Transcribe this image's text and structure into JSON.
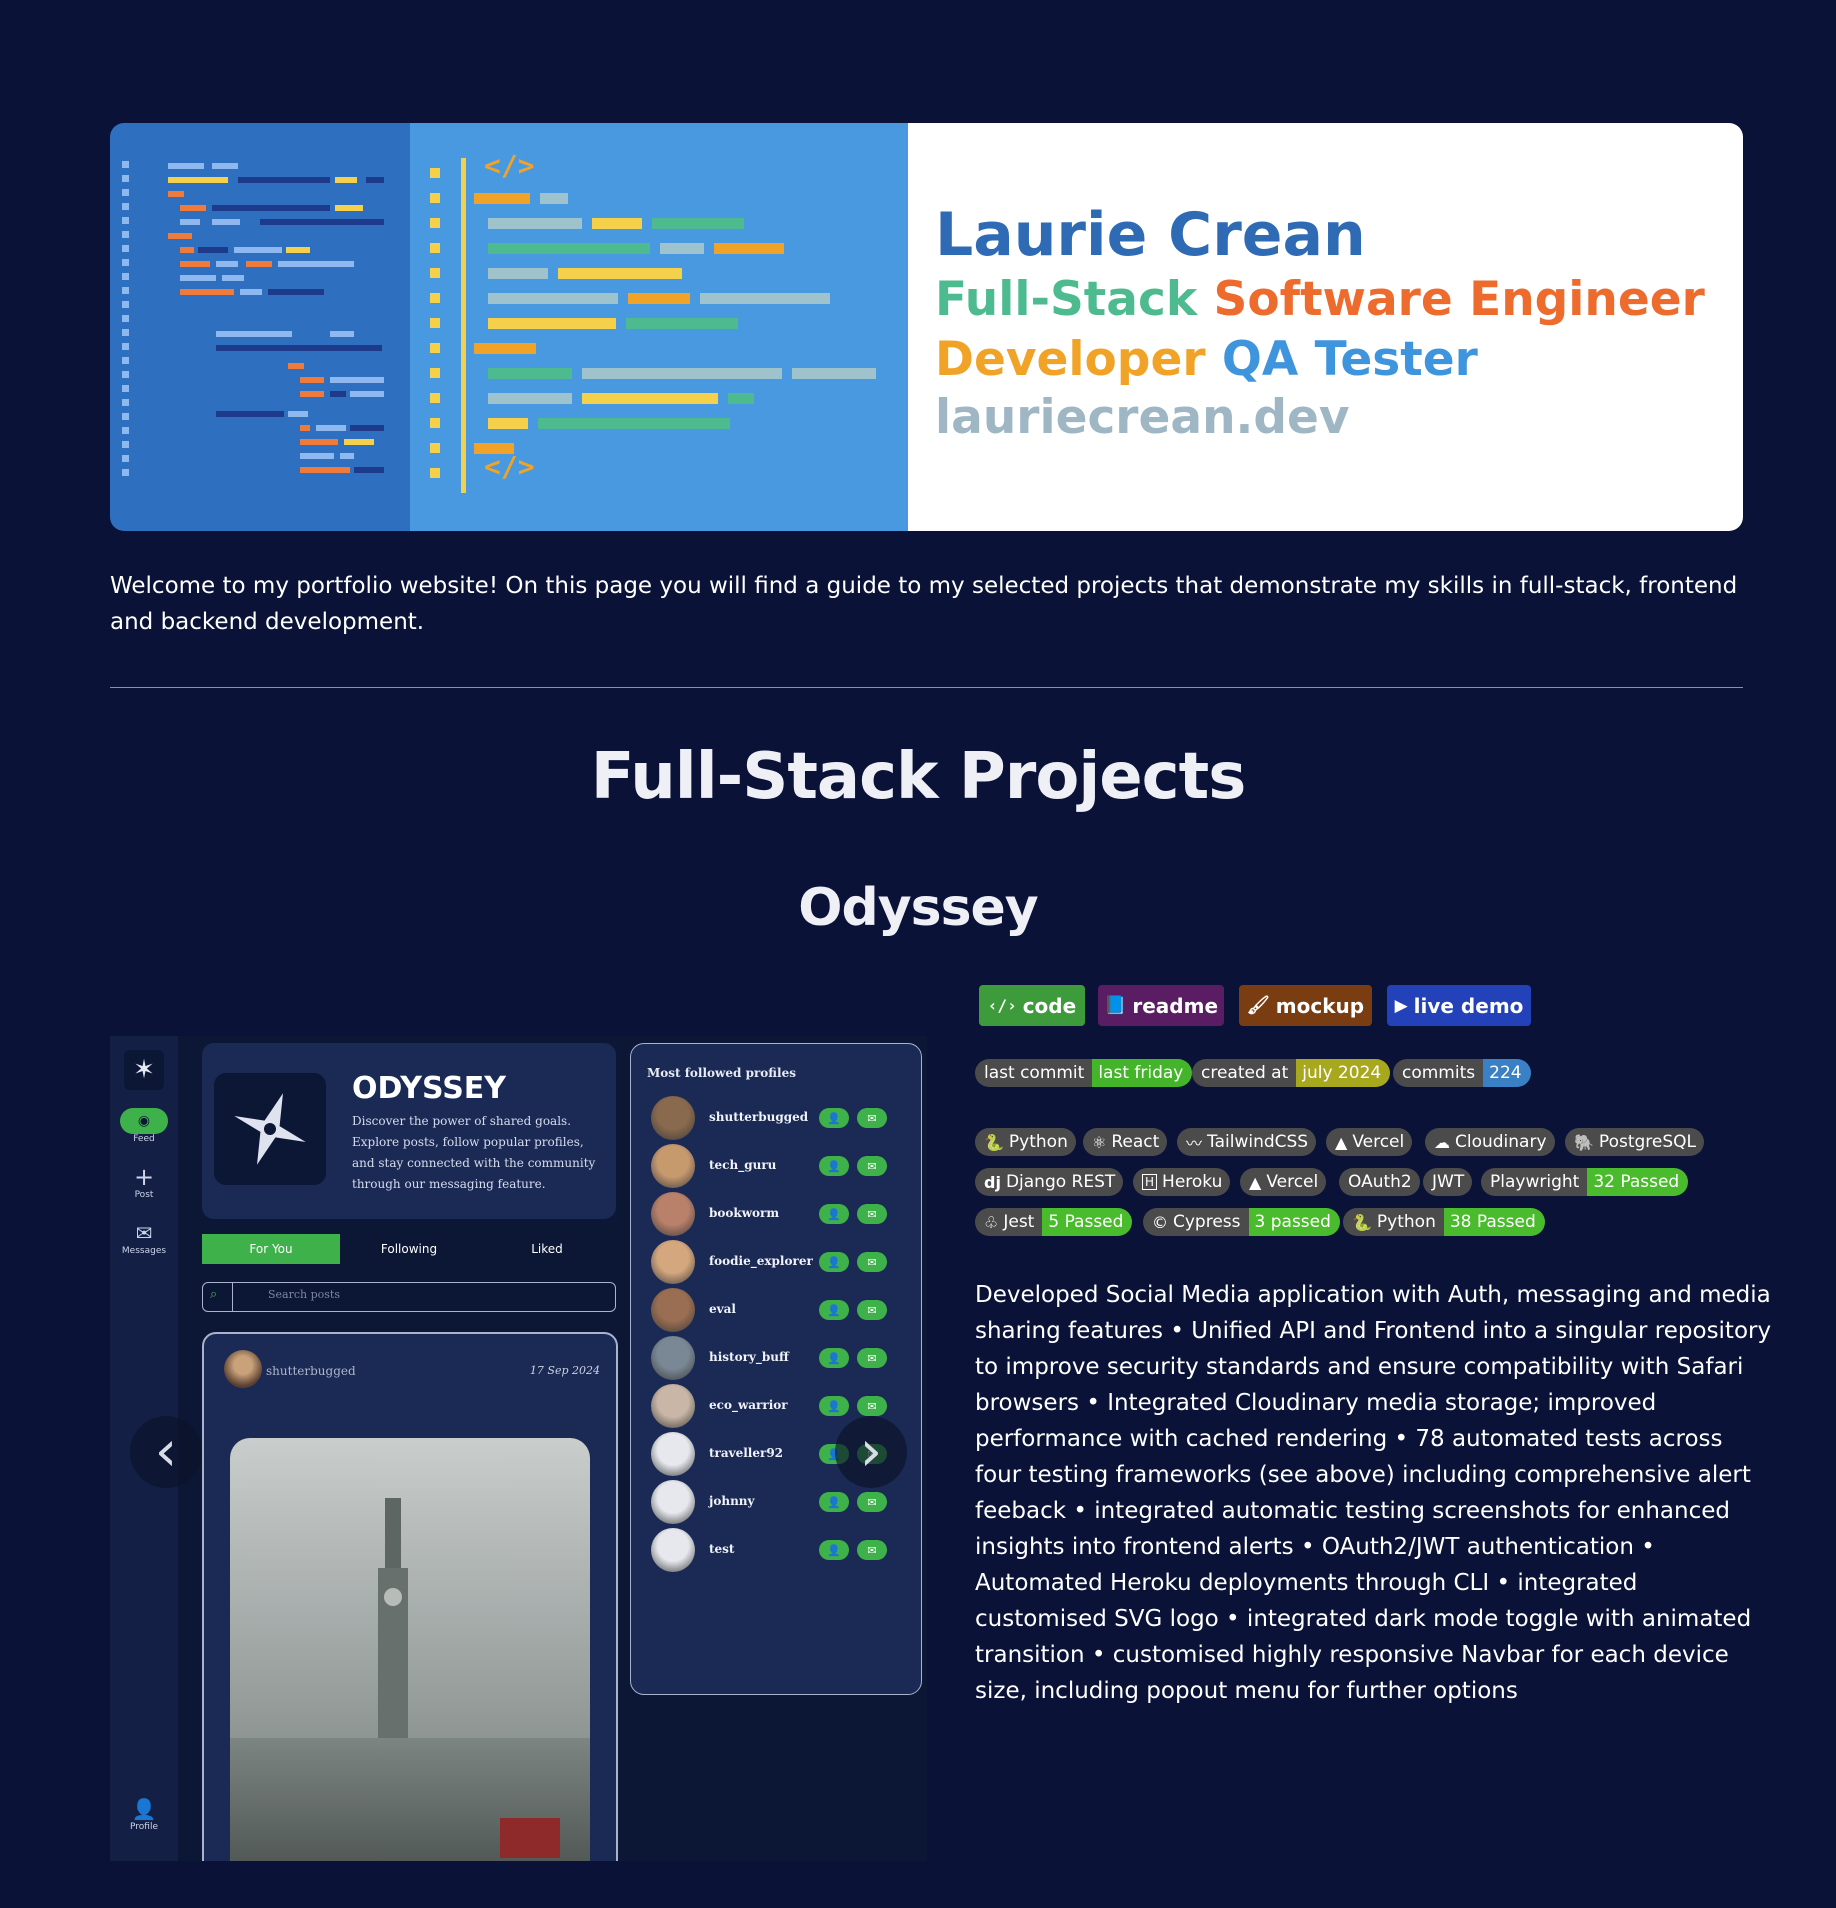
{
  "banner": {
    "name": "Laurie Crean",
    "role_part1": "Full-Stack",
    "role_part2": "Software Engineer",
    "role_part3": "Developer",
    "role_part4": "QA Tester",
    "domain": "lauriecrean.dev",
    "code_tag_top": "</>",
    "code_tag_bottom": "</>",
    "colors": {
      "name": "#2f6bb5",
      "green": "#4dbb8f",
      "orange": "#ec6b2d",
      "amber": "#f0a327",
      "blue": "#3f95dd",
      "gray": "#9fb6c4"
    }
  },
  "intro_text": "Welcome to my portfolio website! On this page you will find a guide to my selected projects that demonstrate my skills in full-stack, frontend and backend development.",
  "section_heading": "Full-Stack Projects",
  "project": {
    "title": "Odyssey",
    "buttons": [
      {
        "icon": "code-icon",
        "label": "code",
        "color": "#3e9b3b"
      },
      {
        "icon": "book-icon",
        "label": "readme",
        "color": "#5a1d63"
      },
      {
        "icon": "brush-icon",
        "label": "mockup",
        "color": "#7a3d12"
      },
      {
        "icon": "play-icon",
        "label": "live demo",
        "color": "#2341b8"
      }
    ],
    "stats": [
      {
        "label": "last commit",
        "value": "last friday",
        "color": "#44b52b"
      },
      {
        "label": "created at",
        "value": "july 2024",
        "color": "#a8a81f"
      },
      {
        "label": "commits",
        "value": "224",
        "color": "#3a80c4"
      }
    ],
    "tech": [
      {
        "icon": "python-icon",
        "glyph": "🐍",
        "label": "Python"
      },
      {
        "icon": "react-icon",
        "glyph": "⚛",
        "label": "React"
      },
      {
        "icon": "tailwind-icon",
        "glyph": "〰",
        "label": "TailwindCSS"
      },
      {
        "icon": "vercel-icon",
        "glyph": "▲",
        "label": "Vercel"
      },
      {
        "icon": "cloudinary-icon",
        "glyph": "☁",
        "label": "Cloudinary"
      },
      {
        "icon": "postgresql-icon",
        "glyph": "🐘",
        "label": "PostgreSQL"
      },
      {
        "icon": "django-icon",
        "glyph": "dj",
        "label": "Django REST"
      },
      {
        "icon": "heroku-icon",
        "glyph": "H",
        "label": "Heroku"
      },
      {
        "icon": "vercel-icon",
        "glyph": "▲",
        "label": "Vercel"
      },
      {
        "icon": "",
        "glyph": "",
        "label": "OAuth2"
      },
      {
        "icon": "",
        "glyph": "",
        "label": "JWT"
      }
    ],
    "tests": [
      {
        "icon": "",
        "label": "Playwright",
        "value": "32 Passed"
      },
      {
        "icon": "jest-icon",
        "label": "Jest",
        "value": "5 Passed"
      },
      {
        "icon": "cypress-icon",
        "label": "Cypress",
        "value": "3 passed"
      },
      {
        "icon": "python-icon",
        "label": "Python",
        "value": "38 Passed"
      }
    ],
    "test_color": "#4bbb2e",
    "description": "Developed Social Media application with Auth, messaging and media sharing features • Unified API and Frontend into a singular repository to improve security standards and ensure compatibility with Safari browsers • Integrated Cloudinary media storage; improved performance with cached rendering • 78 automated tests across four testing frameworks (see above) including comprehensive alert feeback • integrated automatic testing screenshots for enhanced insights into frontend alerts • OAuth2/JWT authentication • Automated Heroku deployments through CLI • integrated customised SVG logo • integrated dark mode toggle with animated transition • customised highly responsive Navbar for each device size, including popout menu for further options"
  },
  "screenshot": {
    "sidebar": {
      "feed": "Feed",
      "post": "Post",
      "messages": "Messages",
      "profile": "Profile"
    },
    "hero_title": "ODYSSEY",
    "hero_desc": "Discover the power of shared goals. Explore posts, follow popular profiles, and stay connected with the community through our messaging feature.",
    "tabs": [
      "For You",
      "Following",
      "Liked"
    ],
    "search_placeholder": "Search posts",
    "post": {
      "user": "shutterbugged",
      "date": "17 Sep 2024"
    },
    "most_followed_title": "Most followed profiles",
    "profiles": [
      "shutterbugged",
      "tech_guru",
      "bookworm",
      "foodie_explorer",
      "eval",
      "history_buff",
      "eco_warrior",
      "traveller92",
      "johnny",
      "test"
    ],
    "carousel_prev": "‹",
    "carousel_next": "›"
  }
}
